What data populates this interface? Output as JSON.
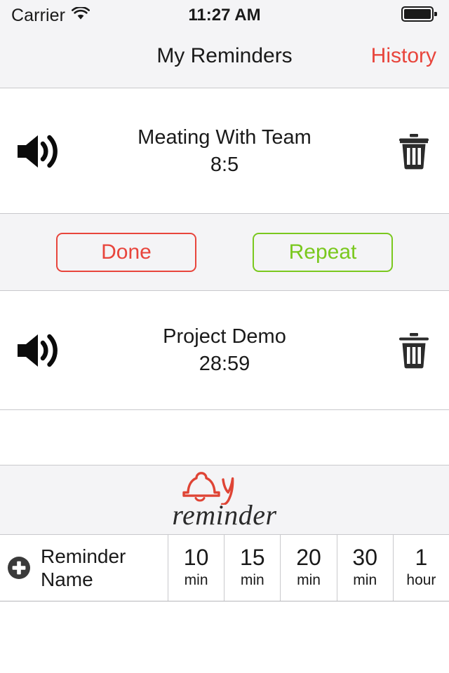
{
  "statusbar": {
    "carrier": "Carrier",
    "wifi_icon": "wifi-icon",
    "time": "11:27 AM",
    "battery_icon": "battery-full-icon"
  },
  "navbar": {
    "title": "My Reminders",
    "action_label": "History"
  },
  "reminders": [
    {
      "speaker_icon": "speaker-volume-icon",
      "name": "Meating With Team",
      "time": "8:5",
      "trash_icon": "trash-icon",
      "actions": {
        "done_label": "Done",
        "repeat_label": "Repeat"
      }
    },
    {
      "speaker_icon": "speaker-volume-icon",
      "name": "Project Demo",
      "time": "28:59",
      "trash_icon": "trash-icon"
    }
  ],
  "brand": {
    "bell_icon": "bell-icon",
    "script_letter": "y",
    "word": "reminder"
  },
  "toolbar": {
    "add_icon": "plus-circle-icon",
    "add_label": "Reminder Name",
    "presets": [
      {
        "value": "10",
        "unit": "min"
      },
      {
        "value": "15",
        "unit": "min"
      },
      {
        "value": "20",
        "unit": "min"
      },
      {
        "value": "30",
        "unit": "min"
      },
      {
        "value": "1",
        "unit": "hour"
      }
    ]
  },
  "colors": {
    "accent_red": "#e8453c",
    "accent_green": "#7ac81e",
    "bar_background": "#f4f4f6",
    "text": "#1a1a1a",
    "divider": "#c9c9cc"
  }
}
